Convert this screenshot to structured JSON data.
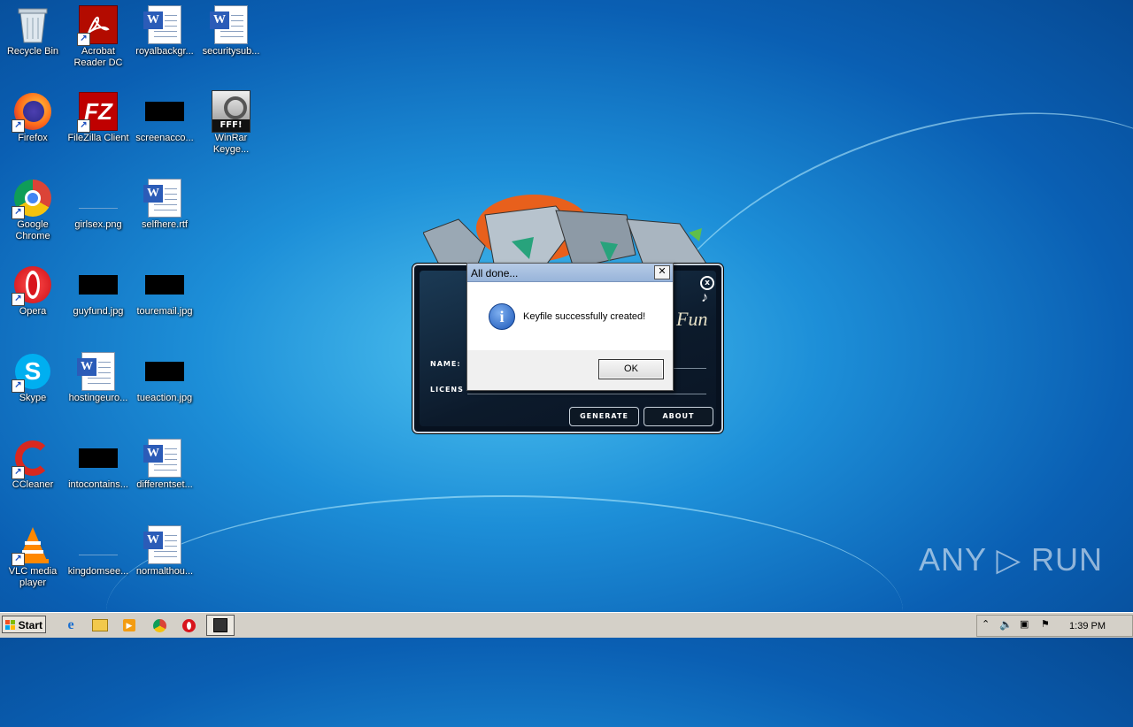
{
  "desktop_icons": [
    {
      "label": "Recycle Bin",
      "icon": "recycle-bin-icon"
    },
    {
      "label": "Acrobat\nReader DC",
      "icon": "acrobat-icon"
    },
    {
      "label": "royalbackgr...",
      "icon": "word-doc-icon"
    },
    {
      "label": "securitysub...",
      "icon": "word-doc-icon"
    },
    {
      "label": "Firefox",
      "icon": "firefox-icon"
    },
    {
      "label": "FileZilla Client",
      "icon": "filezilla-icon"
    },
    {
      "label": "screenacco...",
      "icon": "image-thumb-icon"
    },
    {
      "label": "WinRar\nKeyge...",
      "icon": "winrar-keygen-icon"
    },
    {
      "label": "Google\nChrome",
      "icon": "chrome-icon"
    },
    {
      "label": "girlsex.png",
      "icon": "image-thumb-icon"
    },
    {
      "label": "selfhere.rtf",
      "icon": "word-doc-icon"
    },
    {
      "label": "Opera",
      "icon": "opera-icon"
    },
    {
      "label": "guyfund.jpg",
      "icon": "image-thumb-icon"
    },
    {
      "label": "touremail.jpg",
      "icon": "image-thumb-icon"
    },
    {
      "label": "Skype",
      "icon": "skype-icon"
    },
    {
      "label": "hostingeuro...",
      "icon": "word-doc-icon"
    },
    {
      "label": "tueaction.jpg",
      "icon": "image-thumb-icon"
    },
    {
      "label": "CCleaner",
      "icon": "ccleaner-icon"
    },
    {
      "label": "intocontains...",
      "icon": "image-thumb-icon"
    },
    {
      "label": "differentset...",
      "icon": "word-doc-icon"
    },
    {
      "label": "VLC media\nplayer",
      "icon": "vlc-icon"
    },
    {
      "label": "kingdomsee...",
      "icon": "image-thumb-icon"
    },
    {
      "label": "normalthou...",
      "icon": "word-doc-icon"
    }
  ],
  "keygen": {
    "name_label": "NAME:",
    "license_label": "LICENS",
    "generate_label": "GENERATE",
    "about_label": "ABOUT",
    "fun_text": "Fun"
  },
  "dialog": {
    "title": "All done...",
    "close_glyph": "✕",
    "message": "Keyfile successfully created!",
    "ok_label": "OK"
  },
  "watermark": "ANY ▷ RUN",
  "taskbar": {
    "start_label": "Start",
    "clock": "1:39 PM"
  }
}
